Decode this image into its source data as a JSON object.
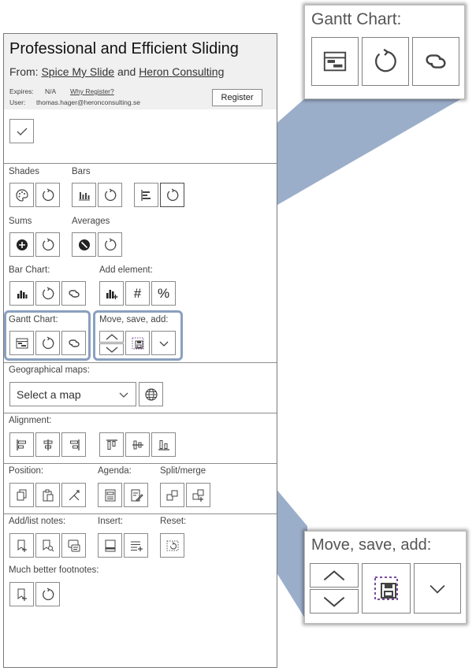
{
  "addin": {
    "title": "Professional and Efficient Sliding",
    "from_prefix": "From:",
    "from_link1": "Spice My Slide",
    "from_and": "and",
    "from_link2": "Heron Consulting",
    "expires_label": "Expires:",
    "expires_value": "N/A",
    "why_register": "Why Register?",
    "user_label": "User:",
    "user_value": "thomas.hager@heronconsulting.se",
    "register_button": "Register"
  },
  "sections": {
    "shades": "Shades",
    "bars": "Bars",
    "sums": "Sums",
    "averages": "Averages",
    "bar_chart": "Bar Chart:",
    "add_element": "Add element:",
    "gantt_chart": "Gantt Chart:",
    "move_save_add": "Move, save, add:",
    "geo_maps": "Geographical maps:",
    "alignment": "Alignment:",
    "position": "Position:",
    "agenda": "Agenda:",
    "split_merge": "Split/merge",
    "add_list_notes": "Add/list notes:",
    "insert": "Insert:",
    "reset": "Reset:",
    "footnotes": "Much better footnotes:"
  },
  "map_select": {
    "value": "Select a map"
  },
  "add_element_symbols": {
    "hash": "#",
    "percent": "%"
  },
  "zoom_gantt": {
    "title": "Gantt Chart:"
  },
  "zoom_move": {
    "title": "Move, save, add:"
  },
  "colors": {
    "callout": "#8aa0bf",
    "border": "#8a8a8a",
    "header_bg": "#f0f0f0"
  }
}
